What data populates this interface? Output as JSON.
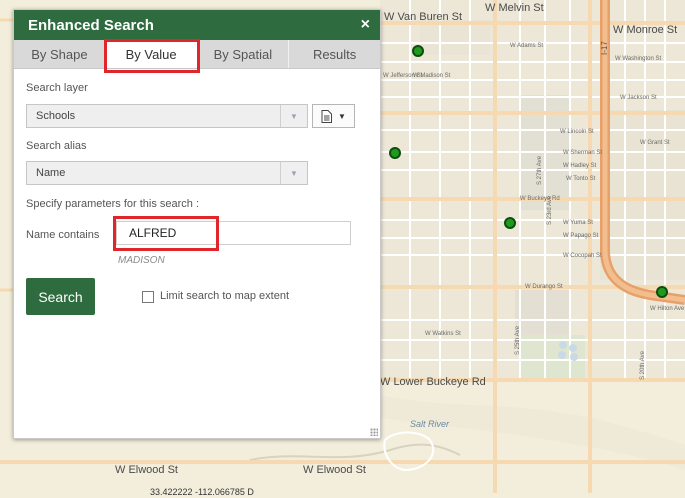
{
  "panel": {
    "title": "Enhanced Search",
    "close_symbol": "×",
    "tabs": [
      {
        "label": "By Shape",
        "active": false
      },
      {
        "label": "By Value",
        "active": true
      },
      {
        "label": "By Spatial",
        "active": false
      },
      {
        "label": "Results",
        "active": false
      }
    ],
    "search_layer_label": "Search layer",
    "search_layer_value": "Schools",
    "search_alias_label": "Search alias",
    "search_alias_value": "Name",
    "params_label": "Specify parameters for this search :",
    "name_contains_label": "Name contains",
    "name_contains_value": "ALFRED",
    "hint": "MADISON",
    "search_button": "Search",
    "limit_extent_label": "Limit search to map extent",
    "limit_extent_checked": false,
    "accent_color": "#2e6b3e",
    "highlight_color": "#e0262b"
  },
  "map": {
    "streets": [
      "W Van Buren St",
      "W Melvin St",
      "W Monroe St",
      "W Elwood St",
      "W Lower Buckeye Rd",
      "Salt River",
      "W Buckeye Rd",
      "W Durango St",
      "W Adams St",
      "W Madison St",
      "W Jefferson St",
      "W Washington St",
      "W Jackson St",
      "W Lincoln St",
      "W Grant St",
      "W Sherman St",
      "W Hadley St",
      "W Tonto St",
      "W Yuma St",
      "W Papago St",
      "W Cocopah St",
      "W Watkins St",
      "W Hilton Ave",
      "S 27th Ave",
      "S 25th Ave",
      "S 23rd Ave",
      "S 20th Ave",
      "I-17"
    ],
    "marker_icon": "school-marker-icon",
    "marker_color": "#1f9a1f",
    "coordinates": "33.422222  -112.066785 D"
  }
}
